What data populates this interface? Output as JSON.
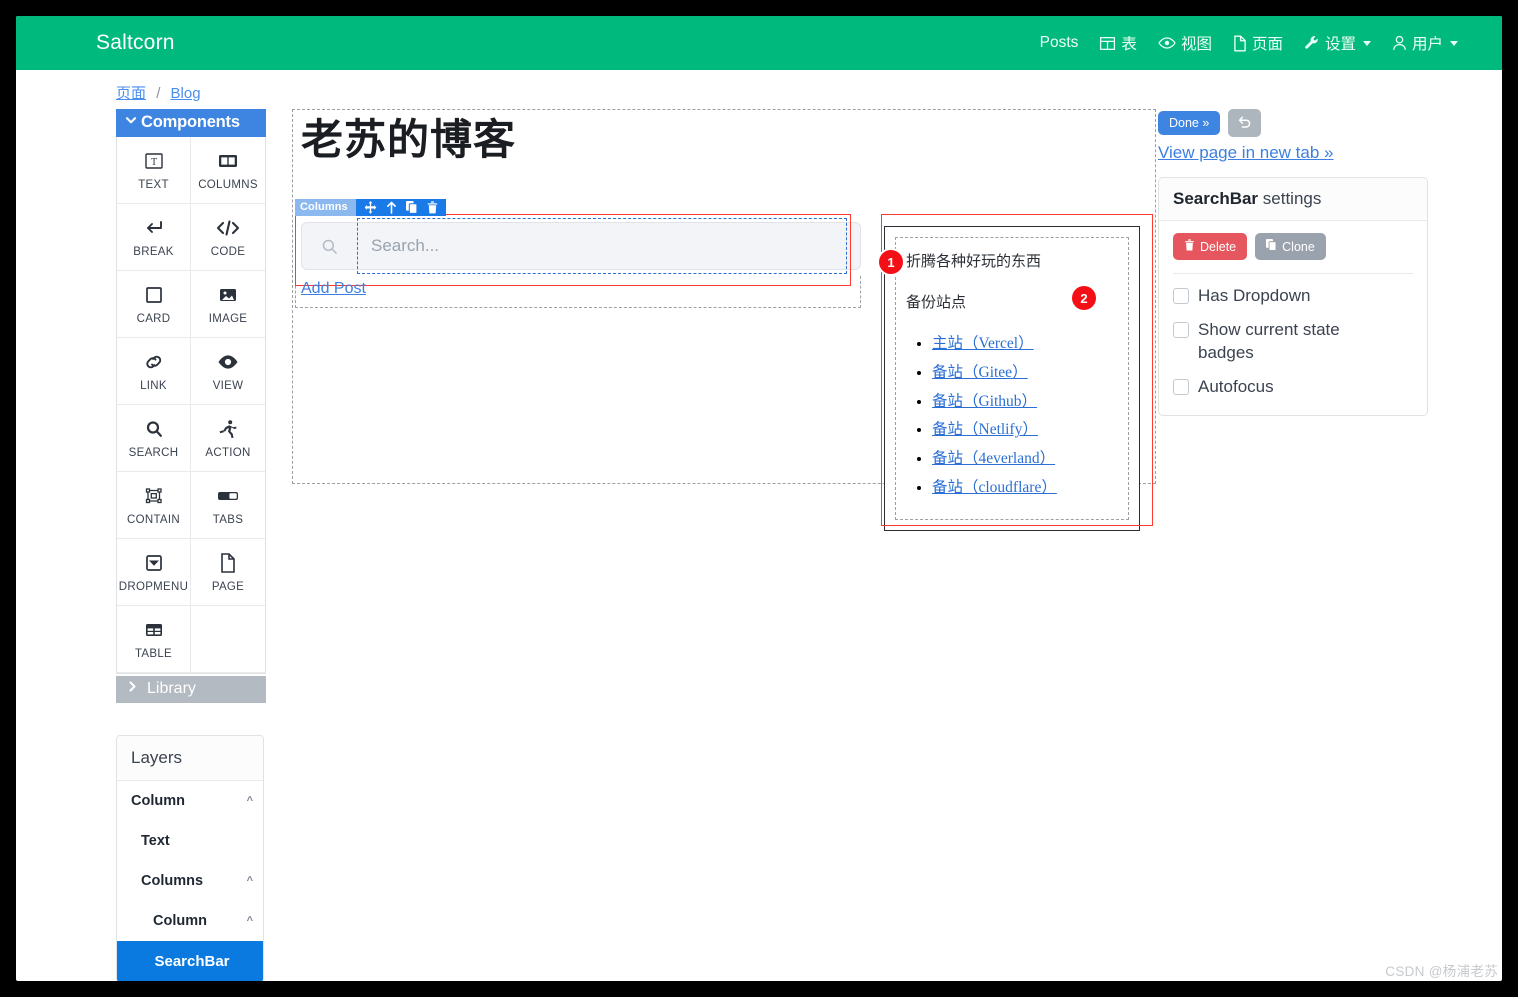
{
  "navbar": {
    "brand": "Saltcorn",
    "items": [
      {
        "label": "Posts",
        "icon": "",
        "caret": false
      },
      {
        "label": "表",
        "icon": "table-icon",
        "caret": false
      },
      {
        "label": "视图",
        "icon": "eye-icon",
        "caret": false
      },
      {
        "label": "页面",
        "icon": "file-icon",
        "caret": false
      },
      {
        "label": "设置",
        "icon": "wrench-icon",
        "caret": true
      },
      {
        "label": "用户",
        "icon": "user-icon",
        "caret": true
      }
    ]
  },
  "breadcrumb": {
    "root": "页面",
    "sep": "/",
    "current": "Blog"
  },
  "left_panel": {
    "components_header": "Components",
    "components": [
      {
        "label": "TEXT",
        "icon": "text-icon"
      },
      {
        "label": "COLUMNS",
        "icon": "columns-icon"
      },
      {
        "label": "BREAK",
        "icon": "break-icon"
      },
      {
        "label": "CODE",
        "icon": "code-icon"
      },
      {
        "label": "CARD",
        "icon": "card-icon"
      },
      {
        "label": "IMAGE",
        "icon": "image-icon"
      },
      {
        "label": "LINK",
        "icon": "link-icon"
      },
      {
        "label": "VIEW",
        "icon": "view-icon"
      },
      {
        "label": "SEARCH",
        "icon": "search-icon"
      },
      {
        "label": "ACTION",
        "icon": "action-icon"
      },
      {
        "label": "CONTAIN",
        "icon": "contain-icon"
      },
      {
        "label": "TABS",
        "icon": "tabs-icon"
      },
      {
        "label": "DROPMENU",
        "icon": "dropmenu-icon"
      },
      {
        "label": "PAGE",
        "icon": "page-icon"
      },
      {
        "label": "TABLE",
        "icon": "table-grid-icon"
      }
    ],
    "library_label": "Library",
    "layers_title": "Layers",
    "layers": [
      {
        "label": "Column",
        "indent": 0,
        "chevron": "^",
        "selected": false
      },
      {
        "label": "Text",
        "indent": 1,
        "chevron": "",
        "selected": false
      },
      {
        "label": "Columns",
        "indent": 1,
        "chevron": "^",
        "selected": false
      },
      {
        "label": "Column",
        "indent": 2,
        "chevron": "^",
        "selected": false
      },
      {
        "label": "SearchBar",
        "indent": 3,
        "chevron": "",
        "selected": true
      }
    ]
  },
  "canvas": {
    "page_title": "老苏的博客",
    "block_tag": "Columns",
    "tools": [
      "move-icon",
      "arrow-up-icon",
      "clone-icon",
      "trash-icon"
    ],
    "search_placeholder": "Search...",
    "search_value": "",
    "add_post_label": "Add Post",
    "badge_one": "1",
    "badge_two": "2",
    "card": {
      "line1": "折腾各种好玩的东西",
      "line2": "备份站点",
      "links": [
        "主站（Vercel）",
        "备站（Gitee）",
        "备站（Github）",
        "备站（Netlify）",
        "备站（4everland）",
        "备站（cloudflare）"
      ]
    }
  },
  "right_panel": {
    "done_label": "Done »",
    "undo_icon": "undo-icon",
    "view_page_link": "View page in new tab »",
    "settings_title_bold": "SearchBar",
    "settings_title_rest": " settings",
    "delete_label": "Delete",
    "clone_label": "Clone",
    "checkboxes": [
      {
        "label": "Has Dropdown",
        "checked": false
      },
      {
        "label": "Show current state badges",
        "checked": false
      },
      {
        "label": "Autofocus",
        "checked": false
      }
    ]
  },
  "watermark": "CSDN @杨浦老苏",
  "colors": {
    "navbar_green": "#00b97c",
    "accent_blue": "#3d85e0",
    "selected_blue": "#0a7ae0",
    "danger_red": "#e5565f",
    "badge_red": "#f40f16",
    "outline_red": "#ff3b30",
    "library_gray": "#b3bac1"
  }
}
